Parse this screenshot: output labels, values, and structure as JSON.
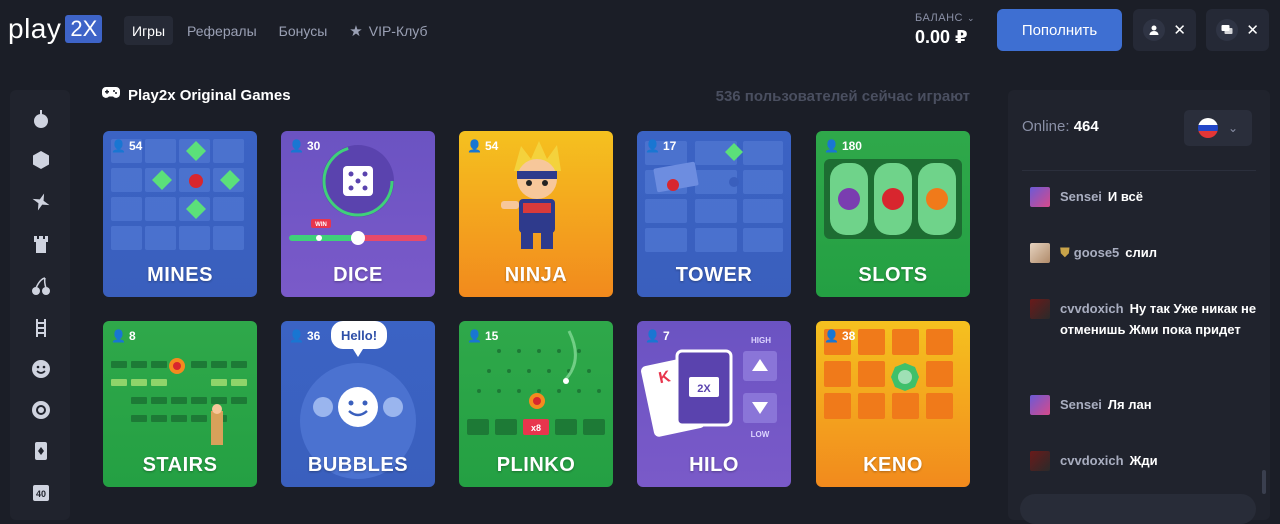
{
  "header": {
    "logo_text": "play",
    "logo_badge": "2X",
    "nav": [
      {
        "label": "Игры",
        "active": true
      },
      {
        "label": "Рефералы",
        "active": false
      },
      {
        "label": "Бонусы",
        "active": false
      },
      {
        "label": "VIP-Клуб",
        "active": false,
        "icon": "star-icon"
      }
    ],
    "balance_label": "БАЛАНС",
    "balance_value": "0.00 ₽",
    "deposit_label": "Пополнить"
  },
  "sidebar": {
    "icons": [
      "mines-icon",
      "hexagon-icon",
      "shuriken-icon",
      "tower-icon",
      "cherry-icon",
      "ladder-icon",
      "smile-icon",
      "target-icon",
      "cards-icon",
      "hilo-icon"
    ]
  },
  "main": {
    "title": "Play2x Original Games",
    "online_users": "536 пользователей сейчас играют",
    "games": [
      {
        "name": "MINES",
        "count": "54",
        "color_top": "#3b63c4",
        "color_bottom": "#3a5fbd"
      },
      {
        "name": "DICE",
        "count": "30",
        "color_top": "#6b53c2",
        "color_bottom": "#7a5ac9"
      },
      {
        "name": "NINJA",
        "count": "54",
        "color_top": "#f5c11f",
        "color_bottom": "#f28a1d"
      },
      {
        "name": "TOWER",
        "count": "17",
        "color_top": "#3b63c4",
        "color_bottom": "#3a5fbd"
      },
      {
        "name": "SLOTS",
        "count": "180",
        "color_top": "#2fa84a",
        "color_bottom": "#24a043"
      },
      {
        "name": "STAIRS",
        "count": "8",
        "color_top": "#2fa84a",
        "color_bottom": "#24a043"
      },
      {
        "name": "BUBBLES",
        "count": "36",
        "color_top": "#3b63c4",
        "color_bottom": "#3a5fbd"
      },
      {
        "name": "PLINKO",
        "count": "15",
        "color_top": "#2fa84a",
        "color_bottom": "#24a043"
      },
      {
        "name": "HILO",
        "count": "7",
        "color_top": "#6b53c2",
        "color_bottom": "#7a5ac9"
      },
      {
        "name": "KENO",
        "count": "38",
        "color_top": "#f5c11f",
        "color_bottom": "#f28a1d"
      }
    ],
    "bubbles_text": "Hello!",
    "hilo_high": "HIGH",
    "hilo_low": "LOW",
    "hilo_card": "2X",
    "hilo_letter": "K",
    "dice_win": "WIN",
    "plinko_mult": "x8"
  },
  "chat": {
    "online_label": "Online:",
    "online_count": "464",
    "messages": [
      {
        "user": "Sensei",
        "text": "И всё"
      },
      {
        "user": "goose5",
        "text": "слил"
      },
      {
        "user": "cvvdoxich",
        "text": "Ну так Уже никак не отменишь Жми пока придет"
      },
      {
        "user": "Sensei",
        "text": "Ля лан"
      },
      {
        "user": "cvvdoxich",
        "text": "Жди"
      }
    ]
  },
  "colors": {
    "background": "#1b1e27",
    "panel": "#20232d",
    "accent": "#3e6fd2"
  }
}
